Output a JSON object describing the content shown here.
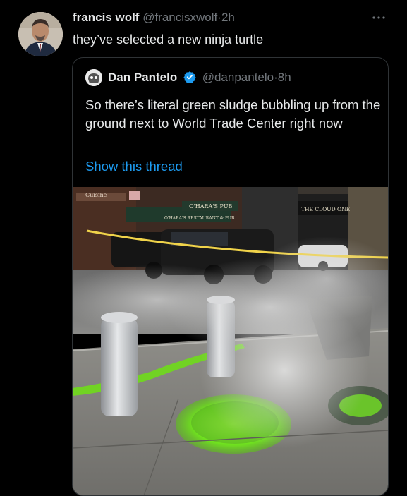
{
  "tweet": {
    "display_name": "francis wolf",
    "handle": "@francisxwolf",
    "separator": "·",
    "time": "2h",
    "text": "they’ve selected a new ninja turtle",
    "more_icon": "more-horizontal-icon"
  },
  "quoted": {
    "display_name": "Dan Pantelo",
    "verified_icon": "verified-badge-icon",
    "handle": "@danpantelo",
    "separator": "·",
    "time": "8h",
    "text": "So there’s literal green sludge bubbling up from the ground next to World Trade Center right now",
    "show_thread": "Show this thread"
  },
  "photo": {
    "signs": {
      "cuisine": "Cuisine",
      "oharas_pub": "O'HARA'S PUB",
      "oharas_restaurant": "O'HARA'S RESTAURANT & PUB",
      "cloud_one": "THE CLOUD ONE"
    }
  },
  "colors": {
    "link": "#1d9bf0",
    "muted": "#71767b",
    "verified": "#1d9bf0",
    "sludge": "#7dff2a"
  }
}
